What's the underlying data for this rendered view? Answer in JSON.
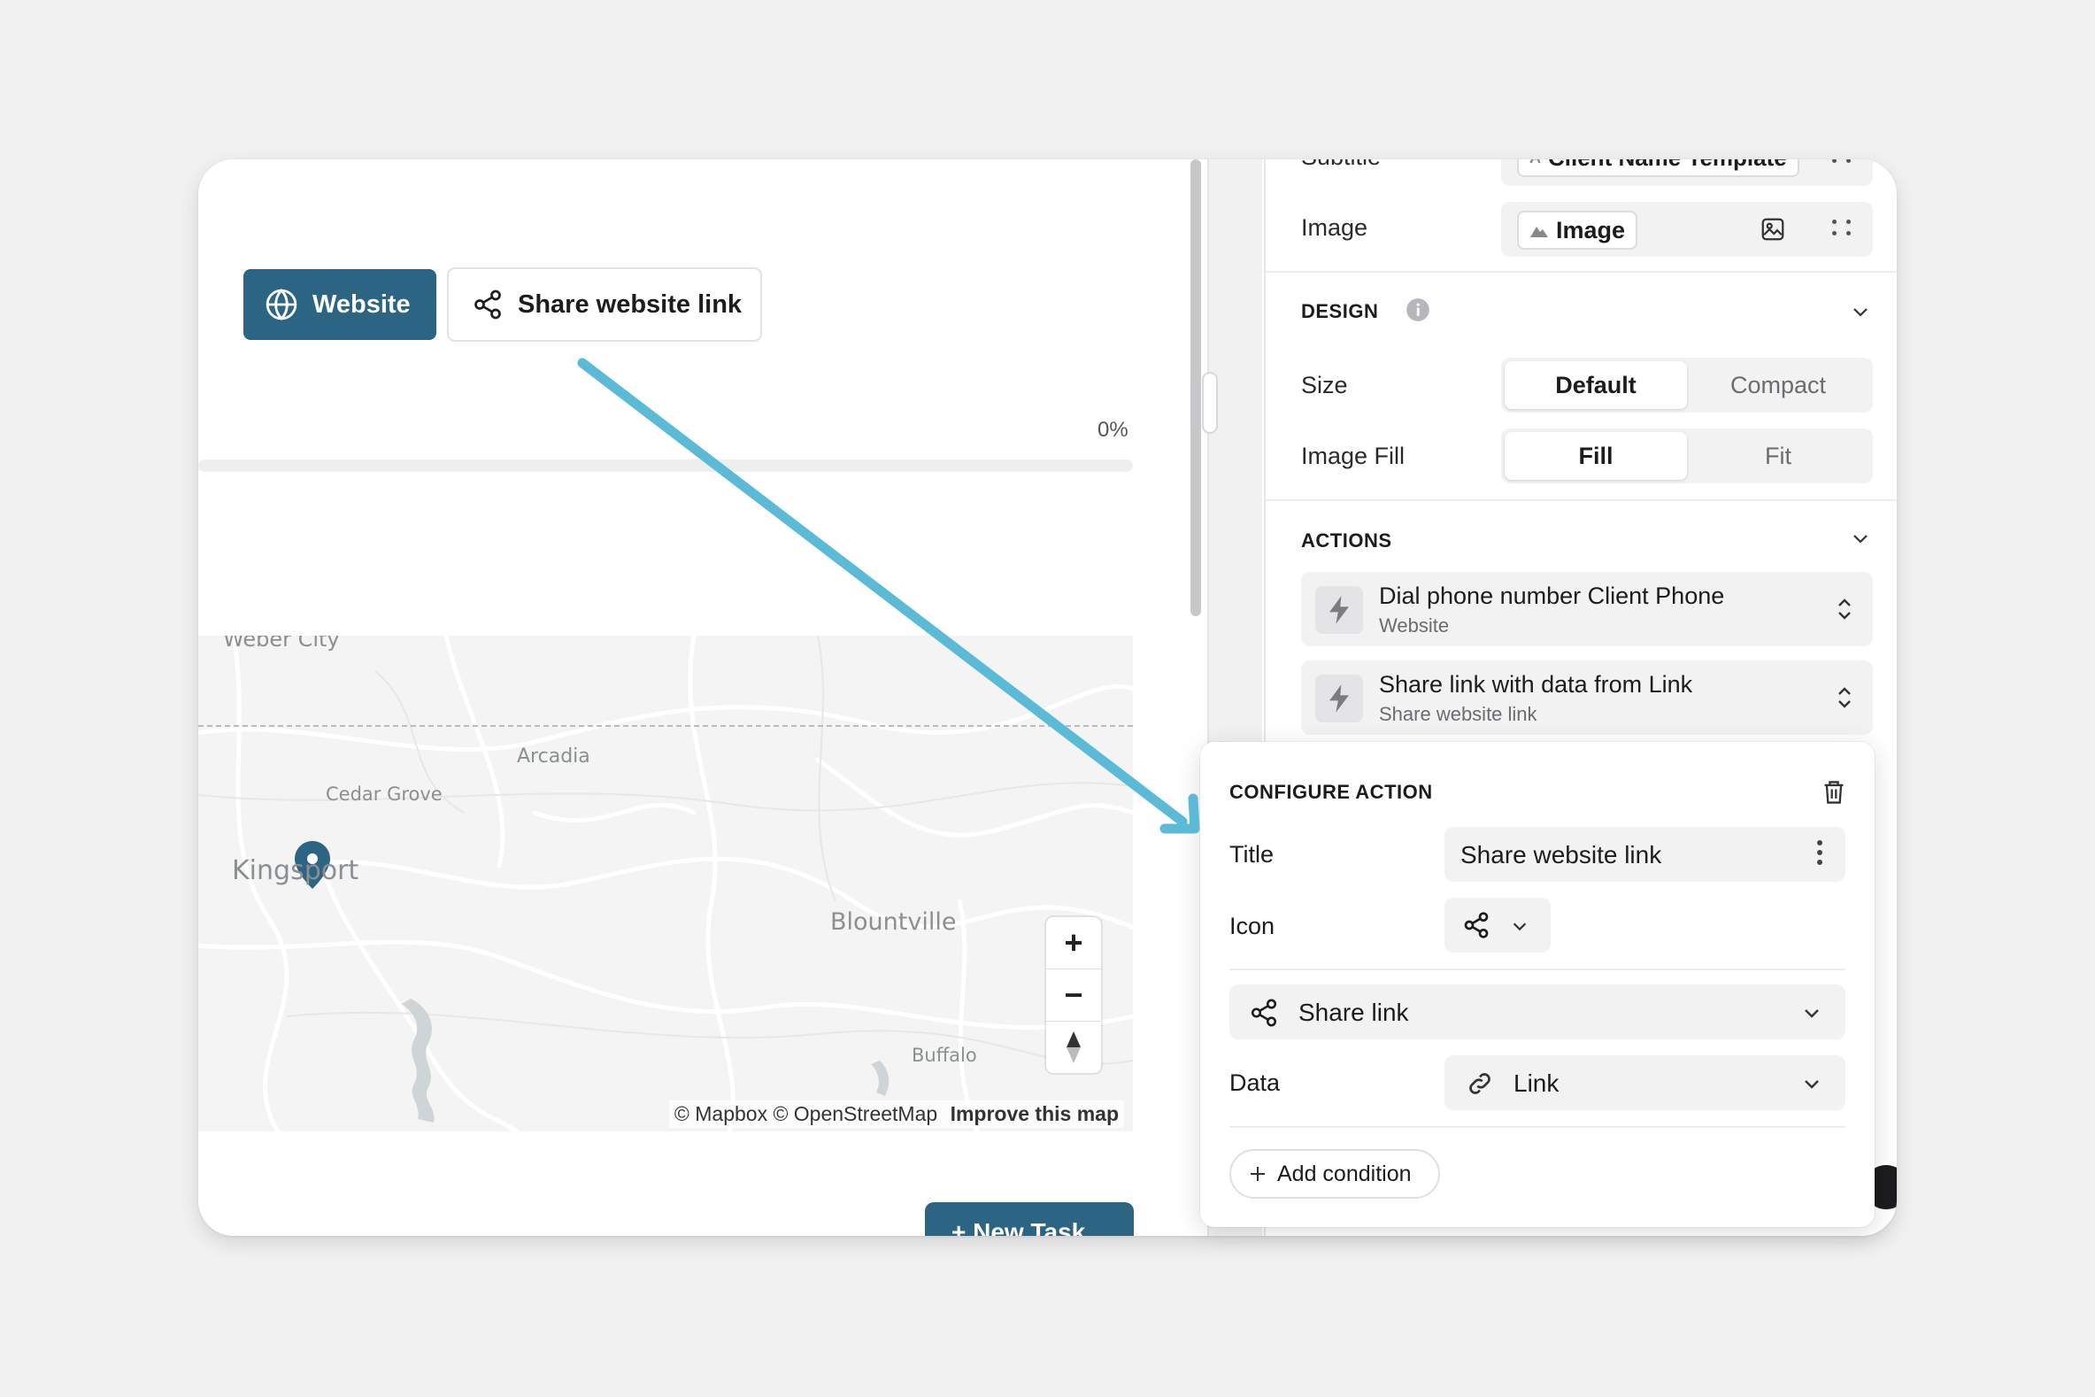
{
  "canvas": {
    "website_button": "Website",
    "share_button": "Share website link",
    "progress": {
      "label": "0%",
      "value": 0
    },
    "map": {
      "labels": {
        "weber_city": "Weber City",
        "arcadia": "Arcadia",
        "cedar_grove": "Cedar Grove",
        "kingsport": "Kingsport",
        "blountville": "Blountville",
        "buffalo": "Buffalo"
      },
      "attribution": "© Mapbox © OpenStreetMap",
      "improve": "Improve this map",
      "zoom_in": "+",
      "zoom_out": "−"
    },
    "new_task_button": "+ New Task"
  },
  "panel": {
    "subtitle": {
      "label": "Subtitle",
      "value": "Client Name Template"
    },
    "image": {
      "label": "Image",
      "value": "Image"
    },
    "design": {
      "title": "DESIGN",
      "size": {
        "label": "Size",
        "options": [
          "Default",
          "Compact"
        ],
        "selected": "Default"
      },
      "image_fill": {
        "label": "Image Fill",
        "options": [
          "Fill",
          "Fit"
        ],
        "selected": "Fill"
      }
    },
    "actions": {
      "title": "ACTIONS",
      "items": [
        {
          "title": "Dial phone number Client Phone",
          "subtitle": "Website"
        },
        {
          "title": "Share link with data from Link",
          "subtitle": "Share website link"
        }
      ]
    }
  },
  "configure": {
    "title": "CONFIGURE ACTION",
    "title_field": {
      "label": "Title",
      "value": "Share website link"
    },
    "icon_field": {
      "label": "Icon",
      "icon": "share-icon"
    },
    "action_select": "Share link",
    "data_field": {
      "label": "Data",
      "value": "Link"
    },
    "add_condition": "Add condition"
  },
  "colors": {
    "primary": "#2c6584",
    "arrow": "#5bbad5",
    "map_pin": "#2c6584"
  }
}
